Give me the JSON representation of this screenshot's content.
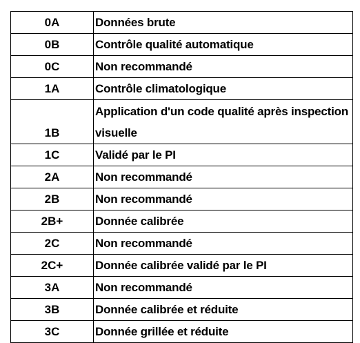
{
  "rows": [
    {
      "code": "0A",
      "description": "Données brute"
    },
    {
      "code": "0B",
      "description": "Contrôle qualité automatique"
    },
    {
      "code": "0C",
      "description": "Non recommandé"
    },
    {
      "code": "1A",
      "description": "Contrôle climatologique"
    },
    {
      "code": "1B",
      "description": "Application d'un code qualité après inspection visuelle"
    },
    {
      "code": "1C",
      "description": "Validé par le PI"
    },
    {
      "code": "2A",
      "description": "Non recommandé"
    },
    {
      "code": "2B",
      "description": "Non recommandé"
    },
    {
      "code": "2B+",
      "description": "Donnée calibrée"
    },
    {
      "code": "2C",
      "description": "Non recommandé"
    },
    {
      "code": "2C+",
      "description": "Donnée calibrée validé par le PI"
    },
    {
      "code": "3A",
      "description": "Non recommandé"
    },
    {
      "code": "3B",
      "description": "Donnée calibrée et réduite"
    },
    {
      "code": "3C",
      "description": "Donnée grillée et réduite"
    }
  ]
}
